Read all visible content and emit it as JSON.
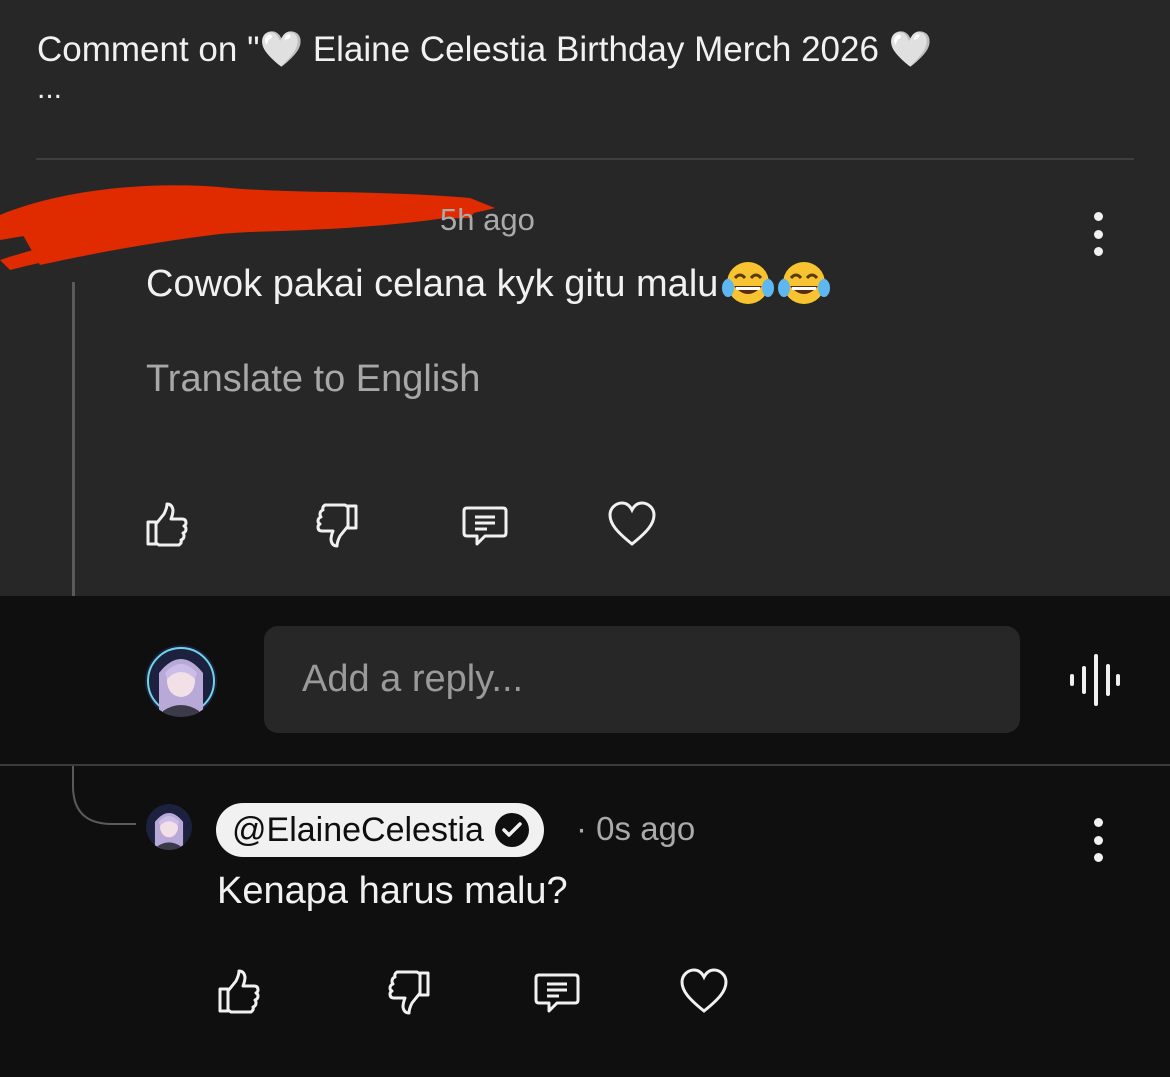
{
  "header": {
    "title": "Comment on \"🤍 Elaine Celestia Birthday Merch 2026 🤍",
    "more": "..."
  },
  "comment": {
    "timestamp": "5h ago",
    "text": "Cowok pakai celana kyk gitu malu",
    "emoji": "face-with-tears-of-joy",
    "translate_label": "Translate to English",
    "author_redacted": true
  },
  "reply_box": {
    "placeholder": "Add a reply..."
  },
  "reply": {
    "author": "@ElaineCelestia",
    "verified": true,
    "separator": "·",
    "timestamp": "0s ago",
    "text": "Kenapa harus malu?"
  },
  "colors": {
    "background": "#0f0f0f",
    "panel": "#272727",
    "text": "#f1f1f1",
    "muted": "#aaaaaa",
    "redaction": "#e02a00"
  },
  "icons": [
    "thumbs-up-icon",
    "thumbs-down-icon",
    "comment-icon",
    "heart-icon",
    "more-vert-icon",
    "voice-search-icon",
    "verified-check-icon"
  ]
}
